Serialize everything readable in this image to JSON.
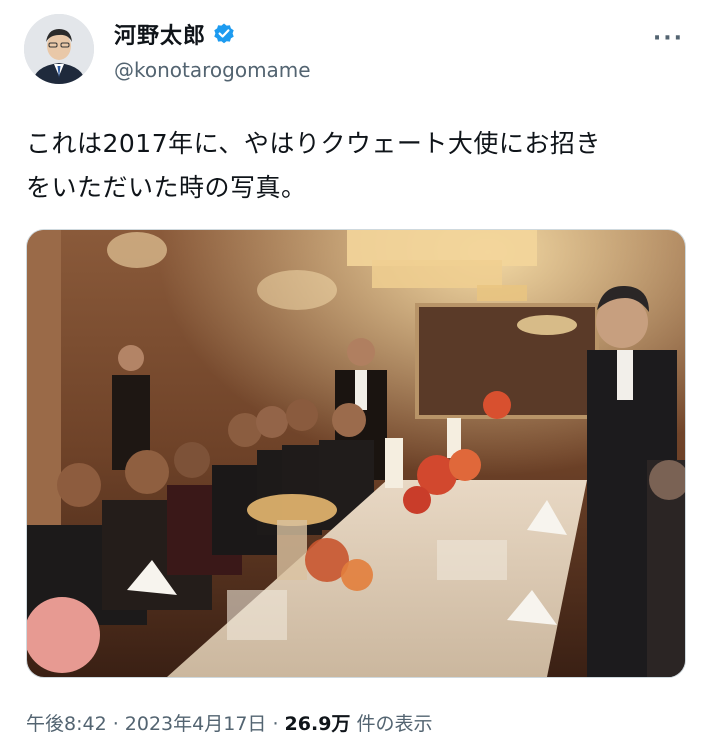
{
  "author": {
    "display_name": "河野太郎",
    "handle": "@konotarogomame",
    "verified_icon": "verified-badge-icon",
    "avatar_icon": "profile-avatar"
  },
  "more_icon": "more-options-icon",
  "more_label": "···",
  "tweet": {
    "line1": "これは2017年に、やはりクウェート大使にお招き",
    "line2": "をいただいた時の写真。"
  },
  "media": {
    "description_icon": "dinner-banquet-photo"
  },
  "meta": {
    "time": "午後8:42",
    "sep1": " · ",
    "date": "2023年4月17日",
    "sep2": " · ",
    "views_count": "26.9万",
    "views_label": " 件の表示"
  },
  "colors": {
    "verified_blue": "#1d9bf0",
    "secondary_text": "#536471",
    "primary_text": "#0f1419"
  }
}
